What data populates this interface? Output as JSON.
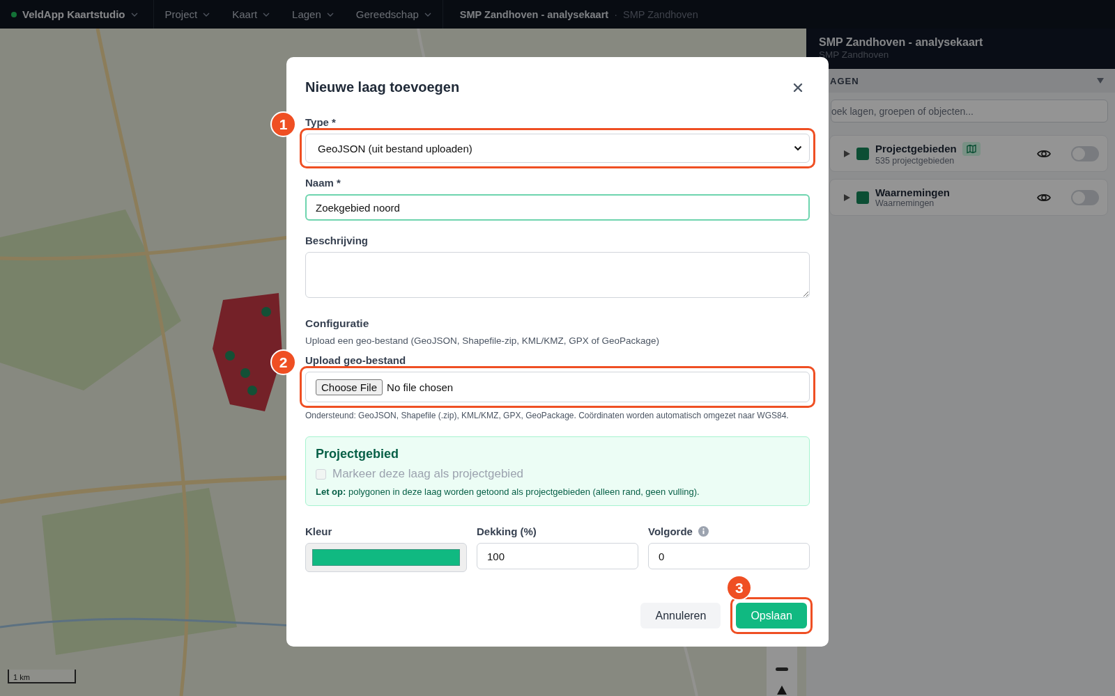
{
  "top_bar": {
    "app_name": "VeldApp Kaartstudio",
    "menus": [
      {
        "label": "Project"
      },
      {
        "label": "Kaart"
      },
      {
        "label": "Lagen"
      },
      {
        "label": "Gereedschap"
      }
    ],
    "project_title": "SMP Zandhoven - analysekaart",
    "separator": "·",
    "project_subtitle": "SMP Zandhoven"
  },
  "map": {
    "scale_label": "1 km"
  },
  "side_panel": {
    "title": "SMP Zandhoven - analysekaart",
    "subtitle": "SMP Zandhoven",
    "section_label": "AGEN",
    "search_placeholder": "oek lagen, groepen of objecten...",
    "layers": [
      {
        "name": "Projectgebieden",
        "detail": "535 projectgebieden",
        "expanded": false,
        "project_area": true,
        "on": false
      },
      {
        "name": "Waarnemingen",
        "detail": "Waarnemingen",
        "expanded": false,
        "project_area": false,
        "on": false
      }
    ]
  },
  "dialog": {
    "title": "Nieuwe laag toevoegen",
    "type_field": {
      "label": "Type *",
      "value": "GeoJSON (uit bestand uploaden)",
      "marker": "1"
    },
    "name_field": {
      "label": "Naam *",
      "value": "Zoekgebied noord",
      "focused": true
    },
    "description_field": {
      "label": "Beschrijving"
    },
    "config": {
      "heading": "Configuratie",
      "help": "Upload een geo-bestand (GeoJSON, Shapefile-zip, KML/KMZ, GPX of GeoPackage)",
      "upload_label": "Upload geo-bestand",
      "button": "Choose File",
      "status": "No file chosen",
      "marker": "2",
      "hint": "Ondersteund: GeoJSON, Shapefile (.zip), KML/KMZ, GPX, GeoPackage. Coördinaten worden automatisch omgezet naar WGS84."
    },
    "project_area": {
      "heading": "Projectgebied",
      "checkbox_label": "Markeer deze laag als projectgebied",
      "checked": false,
      "disabled": true,
      "note": "**Let op:** polygonen in deze laag worden getoond als projectgebieden (alleen rand, geen vulling)."
    },
    "style_fields": [
      {
        "kind": "color",
        "label": "Kleur",
        "color": "#10b981"
      },
      {
        "kind": "number",
        "label": "Dekking (%)",
        "value": "100"
      },
      {
        "kind": "number",
        "label": "Volgorde",
        "value": "0",
        "info": true
      }
    ],
    "buttons": [
      {
        "kind": "secondary",
        "label": "Annuleren"
      },
      {
        "kind": "primary",
        "label": "Opslaan",
        "marker": "3"
      }
    ]
  }
}
